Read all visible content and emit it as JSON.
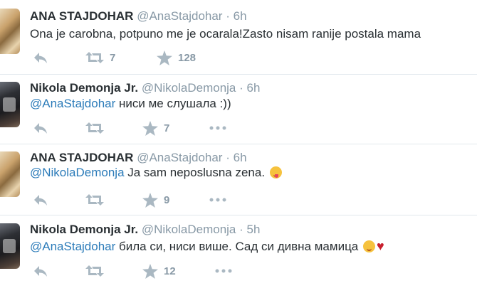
{
  "tweets": [
    {
      "name": "ANA STAJDOHAR",
      "handle": "@AnaStajdohar",
      "separator": "·",
      "time": "6h",
      "mention": "",
      "text": "Ona je carobna, potpuno me je ocarala!Zasto nisam ranije postala mama",
      "retweets": "7",
      "likes": "128"
    },
    {
      "name": "Nikola Demonja Jr.",
      "handle": "@NikolaDemonja",
      "separator": "·",
      "time": "6h",
      "mention": "@AnaStajdohar",
      "text": " ниси ме слушала :))",
      "retweets": "",
      "likes": "7"
    },
    {
      "name": "ANA STAJDOHAR",
      "handle": "@AnaStajdohar",
      "separator": "·",
      "time": "6h",
      "mention": "@NikolaDemonja",
      "text": " Ja sam neposlusna zena.",
      "retweets": "",
      "likes": "9"
    },
    {
      "name": "Nikola Demonja Jr.",
      "handle": "@NikolaDemonja",
      "separator": "·",
      "time": "5h",
      "mention": "@AnaStajdohar",
      "text": " била си, ниси више. Сад си дивна мамица",
      "retweets": "",
      "likes": "12"
    }
  ],
  "icons": {
    "reply": "reply-icon",
    "retweet": "retweet-icon",
    "like": "star-icon",
    "more": "more-icon",
    "emoji_tongue": "face-with-tongue-emoji",
    "emoji_smile": "smiling-face-emoji",
    "heart": "red-heart-emoji"
  },
  "colors": {
    "text": "#292f33",
    "meta": "#8899a6",
    "link": "#2b7bb9",
    "action_icon": "#aab8c2",
    "divider": "#e1e8ed"
  }
}
